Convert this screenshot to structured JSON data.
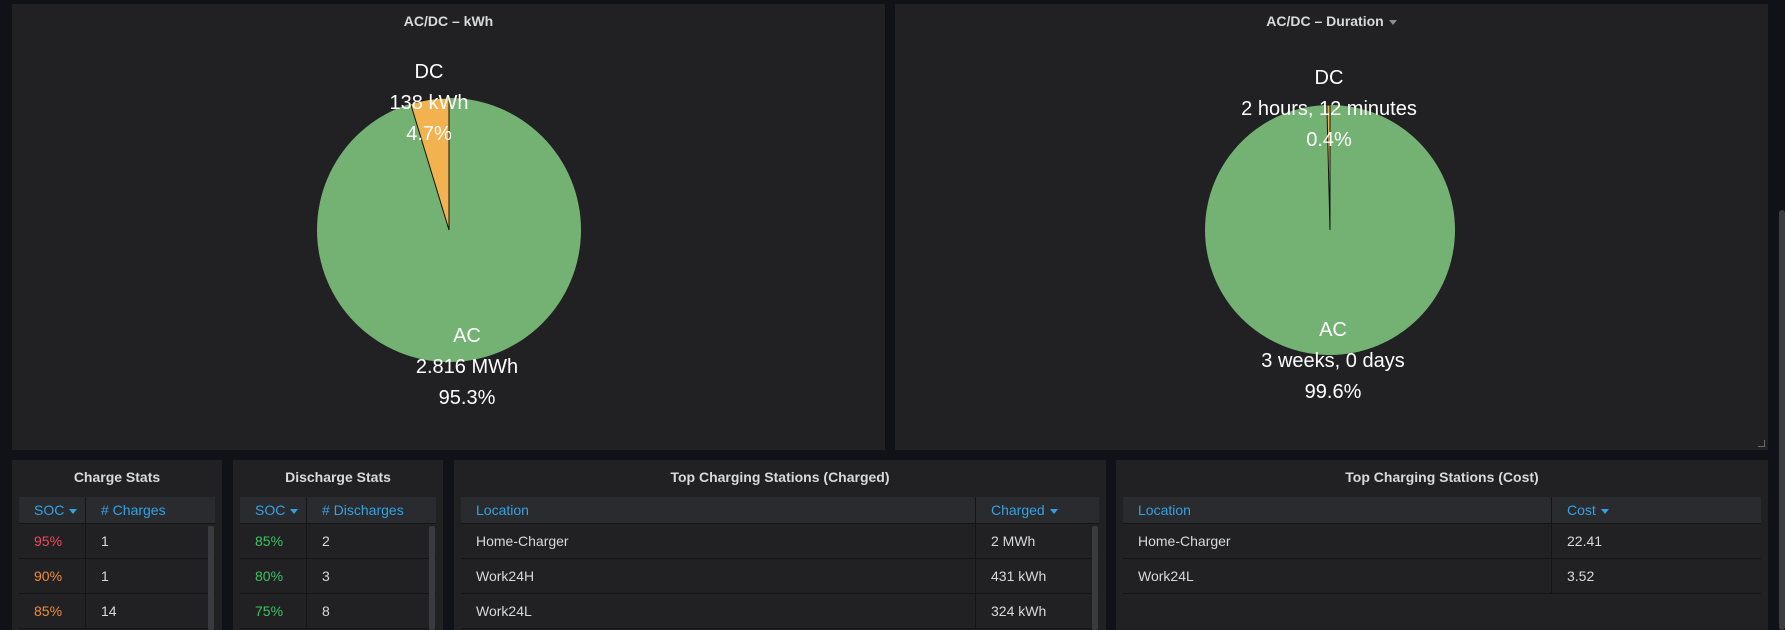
{
  "colors": {
    "ac": "#73b273",
    "dc": "#f2b24f",
    "soc_red": "#f2495c",
    "soc_orange": "#f28b3b",
    "soc_green": "#3bc461",
    "header_blue": "#33a2e5"
  },
  "icons": {
    "panel_menu": "caret-down-icon",
    "sort": "caret-down-icon"
  },
  "kwh_panel": {
    "title": "AC/DC – kWh",
    "chart_data": {
      "type": "pie",
      "title": "AC/DC – kWh",
      "slices": [
        {
          "label": "AC",
          "value_text": "2.816 MWh",
          "percent_text": "95.3%",
          "percent": 95.3
        },
        {
          "label": "DC",
          "value_text": "138 kWh",
          "percent_text": "4.7%",
          "percent": 4.7
        }
      ]
    }
  },
  "duration_panel": {
    "title": "AC/DC – Duration",
    "chart_data": {
      "type": "pie",
      "title": "AC/DC – Duration",
      "slices": [
        {
          "label": "AC",
          "value_text": "3 weeks, 0 days",
          "percent_text": "99.6%",
          "percent": 99.6
        },
        {
          "label": "DC",
          "value_text": "2 hours, 12 minutes",
          "percent_text": "0.4%",
          "percent": 0.4
        }
      ]
    }
  },
  "charge_stats": {
    "title": "Charge Stats",
    "headers": [
      "SOC",
      "# Charges"
    ],
    "rows": [
      {
        "soc": "95%",
        "count": "1",
        "color": "#f2495c"
      },
      {
        "soc": "90%",
        "count": "1",
        "color": "#f28b3b"
      },
      {
        "soc": "85%",
        "count": "14",
        "color": "#f28b3b"
      }
    ]
  },
  "discharge_stats": {
    "title": "Discharge Stats",
    "headers": [
      "SOC",
      "# Discharges"
    ],
    "rows": [
      {
        "soc": "85%",
        "count": "2",
        "color": "#3bc461"
      },
      {
        "soc": "80%",
        "count": "3",
        "color": "#3bc461"
      },
      {
        "soc": "75%",
        "count": "8",
        "color": "#3bc461"
      }
    ]
  },
  "top_charged": {
    "title": "Top Charging Stations (Charged)",
    "headers": [
      "Location",
      "Charged"
    ],
    "rows": [
      {
        "location": "Home-Charger",
        "value": "2 MWh"
      },
      {
        "location": "Work24H",
        "value": "431 kWh"
      },
      {
        "location": "Work24L",
        "value": "324 kWh"
      }
    ]
  },
  "top_cost": {
    "title": "Top Charging Stations (Cost)",
    "headers": [
      "Location",
      "Cost"
    ],
    "rows": [
      {
        "location": "Home-Charger",
        "value": "22.41"
      },
      {
        "location": "Work24L",
        "value": "3.52"
      }
    ]
  }
}
